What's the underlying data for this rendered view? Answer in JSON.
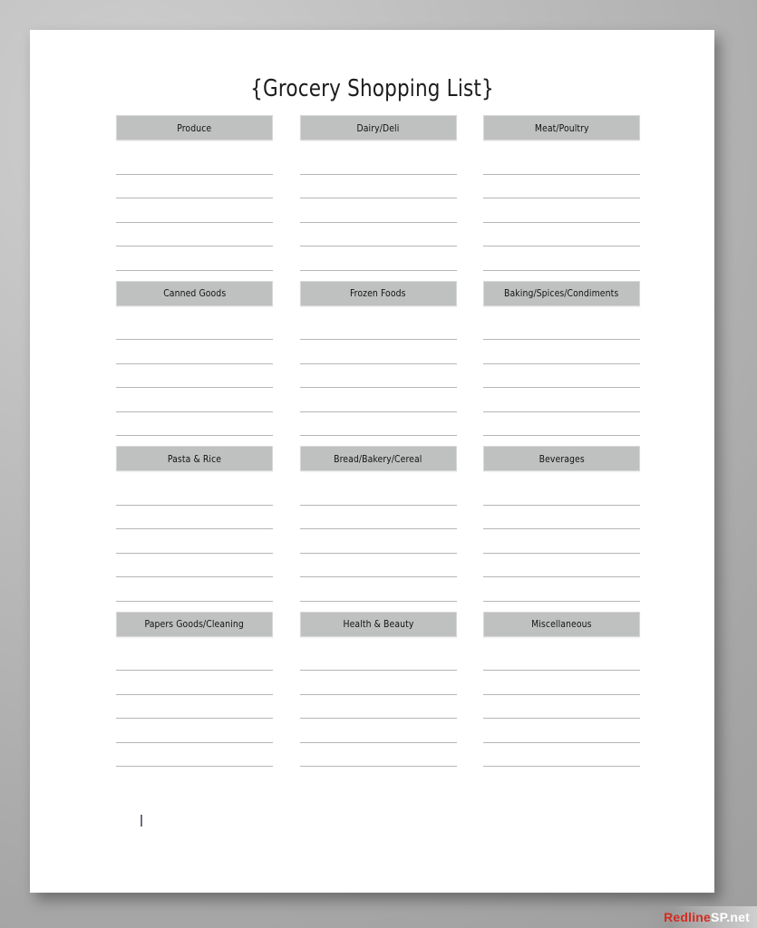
{
  "document": {
    "title": "{Grocery Shopping List}",
    "lines_per_section": 5
  },
  "sections": [
    [
      {
        "label": "Produce"
      },
      {
        "label": "Dairy/Deli"
      },
      {
        "label": "Meat/Poultry"
      }
    ],
    [
      {
        "label": "Canned Goods"
      },
      {
        "label": "Frozen Foods"
      },
      {
        "label": "Baking/Spices/Condiments"
      }
    ],
    [
      {
        "label": "Pasta & Rice"
      },
      {
        "label": "Bread/Bakery/Cereal"
      },
      {
        "label": "Beverages"
      }
    ],
    [
      {
        "label": "Papers Goods/Cleaning"
      },
      {
        "label": "Health & Beauty"
      },
      {
        "label": "Miscellaneous"
      }
    ]
  ],
  "watermark": {
    "brand": "Redline",
    "tld": "SP.net"
  },
  "colors": {
    "header_fill": "#bfc1c0",
    "line": "#b6b6b6",
    "page": "#ffffff",
    "backdrop": "#b2b2b2",
    "watermark_brand": "#d52b1e"
  }
}
